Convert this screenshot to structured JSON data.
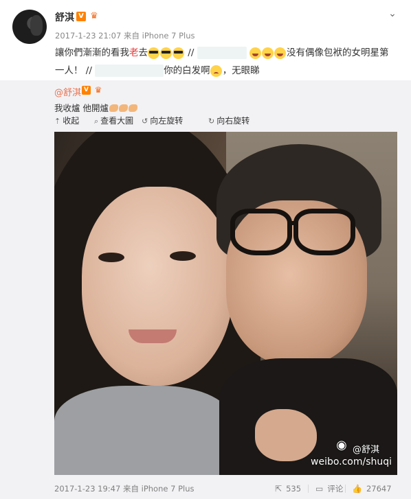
{
  "post": {
    "author": "舒淇",
    "v_badge": "V",
    "crown_icon": "crown-icon",
    "meta": "2017-1-23 21:07 来自 iPhone 7 Plus",
    "line1_before": "讓你們漸漸的看我",
    "line1_red": "老",
    "line1_after": "去",
    "line1_slash": " //",
    "line1_tail": "没有偶像包袱的女明星第",
    "line2_start": "一人！ //",
    "line2_tail": "你的白发啊",
    "line2_end": "，无眼睇"
  },
  "repost": {
    "user": "@舒淇",
    "v_badge": "V",
    "text": "我收爐 他開爐",
    "toolbar": {
      "collapse": "收起",
      "view_large": "查看大圖",
      "rotate_left": "向左旋转",
      "rotate_right": "向右旋转"
    },
    "watermark_name": "@舒淇",
    "watermark_url": "weibo.com/shuqi",
    "footer_meta": "2017-1-23 19:47 来自 iPhone 7 Plus",
    "repost_count": "535",
    "comment_label": "评论",
    "like_count": "27647"
  },
  "colors": {
    "accent_orange": "#eb7350",
    "badge_orange": "#ff8200",
    "red_text": "#e83838",
    "repost_bg": "#f2f2f5"
  }
}
